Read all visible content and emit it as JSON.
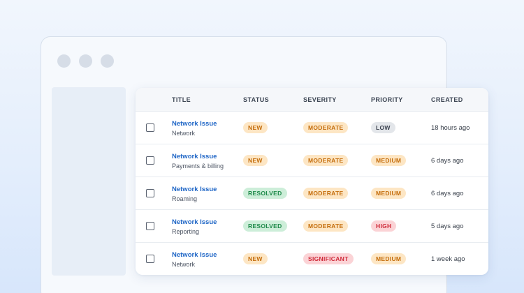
{
  "columns": {
    "title": "TITLE",
    "status": "STATUS",
    "severity": "SEVERITY",
    "priority": "PRIORITY",
    "created": "CREATED"
  },
  "rows": [
    {
      "title": "Network Issue",
      "category": "Network",
      "status": "NEW",
      "severity": "MODERATE",
      "priority": "LOW",
      "created": "18 hours ago"
    },
    {
      "title": "Network Issue",
      "category": "Payments & billing",
      "status": "NEW",
      "severity": "MODERATE",
      "priority": "MEDIUM",
      "created": "6 days ago"
    },
    {
      "title": "Network Issue",
      "category": "Roaming",
      "status": "RESOLVED",
      "severity": "MODERATE",
      "priority": "MEDIUM",
      "created": "6 days ago"
    },
    {
      "title": "Network Issue",
      "category": "Reporting",
      "status": "RESOLVED",
      "severity": "MODERATE",
      "priority": "HIGH",
      "created": "5 days ago"
    },
    {
      "title": "Network Issue",
      "category": "Network",
      "status": "NEW",
      "severity": "SIGNIFICANT",
      "priority": "MEDIUM",
      "created": "1 week ago"
    }
  ],
  "colors": {
    "link": "#1f66c6",
    "badge_orange_bg": "#fde6c4",
    "badge_orange_text": "#c46d0b",
    "badge_green_bg": "#cdeed9",
    "badge_green_text": "#1e8a4a",
    "badge_red_bg": "#fbd3d6",
    "badge_red_text": "#cf2b3a",
    "badge_gray_bg": "#e3e6ea",
    "badge_gray_text": "#3c4350"
  }
}
